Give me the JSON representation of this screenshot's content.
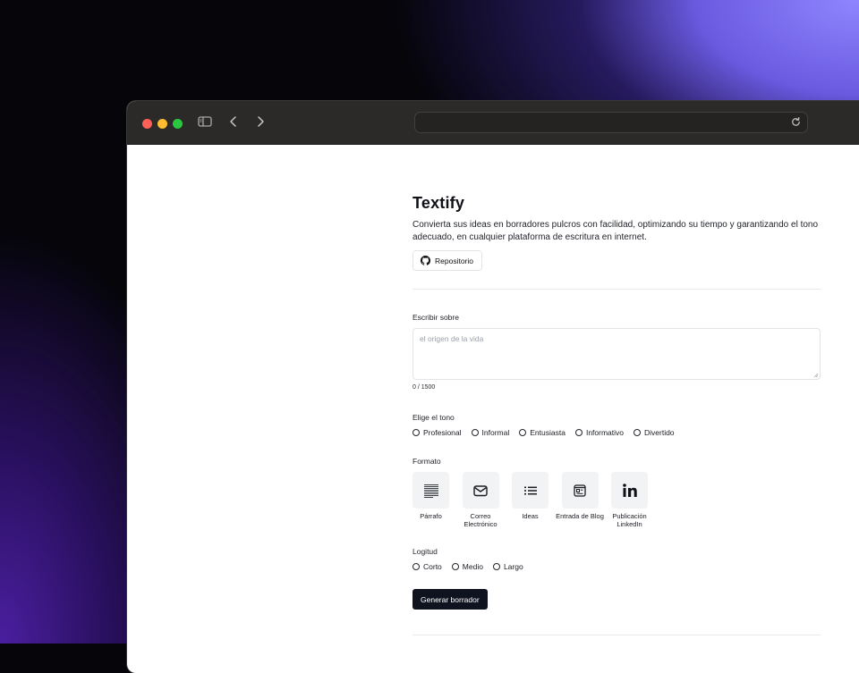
{
  "app": {
    "title": "Textify",
    "description": "Convierta sus ideas en borradores pulcros con facilidad, optimizando su tiempo y garantizando el tono adecuado, en cualquier plataforma de escritura en internet.",
    "repo_button": "Repositorio"
  },
  "topic": {
    "label": "Escribir sobre",
    "placeholder": "el origen de la vida",
    "value": "",
    "counter": "0 / 1500"
  },
  "tone": {
    "label": "Elige el tono",
    "options": [
      "Profesional",
      "Informal",
      "Entusiasta",
      "Informativo",
      "Divertido"
    ]
  },
  "format": {
    "label": "Formato",
    "options": [
      {
        "label": "Párrafo",
        "icon": "paragraph-icon"
      },
      {
        "label": "Correo Electrónico",
        "icon": "mail-icon"
      },
      {
        "label": "Ideas",
        "icon": "list-icon"
      },
      {
        "label": "Entrada de Blog",
        "icon": "blog-icon"
      },
      {
        "label": "Publicación LinkedIn",
        "icon": "linkedin-icon"
      }
    ]
  },
  "length": {
    "label": "Logitud",
    "options": [
      "Corto",
      "Medio",
      "Largo"
    ]
  },
  "generate_button": "Generar borrador",
  "colors": {
    "primary_button": "#0f1320",
    "accent_gradient": "#8f86ff"
  }
}
